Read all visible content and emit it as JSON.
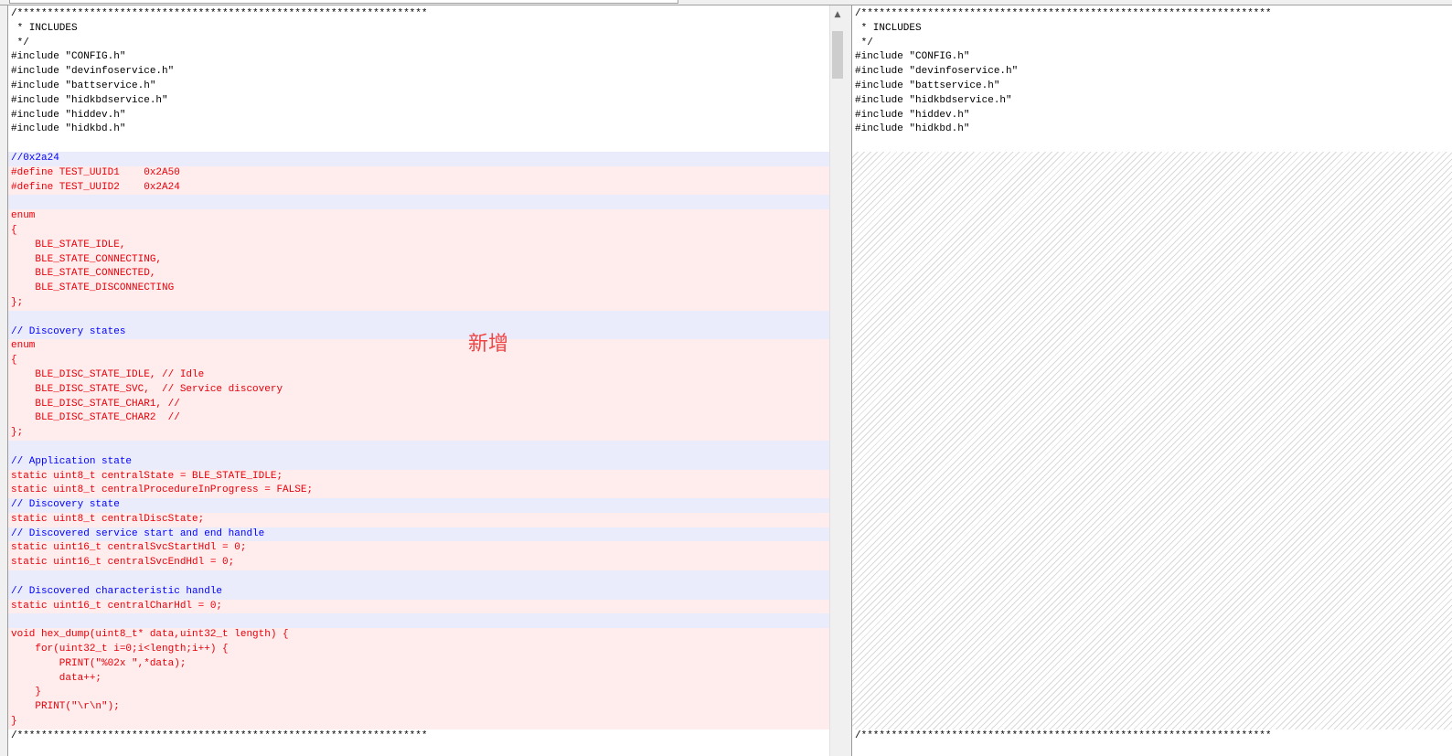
{
  "left_lines": [
    {
      "text": "/********************************************************************",
      "kind": "normal"
    },
    {
      "text": " * INCLUDES",
      "kind": "normal"
    },
    {
      "text": " */",
      "kind": "normal"
    },
    {
      "text": "#include \"CONFIG.h\"",
      "kind": "normal"
    },
    {
      "text": "#include \"devinfoservice.h\"",
      "kind": "normal"
    },
    {
      "text": "#include \"battservice.h\"",
      "kind": "normal"
    },
    {
      "text": "#include \"hidkbdservice.h\"",
      "kind": "normal"
    },
    {
      "text": "#include \"hiddev.h\"",
      "kind": "normal"
    },
    {
      "text": "#include \"hidkbd.h\"",
      "kind": "normal"
    },
    {
      "text": "",
      "kind": "normal"
    },
    {
      "text": "//0x2a24",
      "kind": "comment"
    },
    {
      "text": "#define TEST_UUID1    0x2A50",
      "kind": "added"
    },
    {
      "text": "#define TEST_UUID2    0x2A24",
      "kind": "added"
    },
    {
      "text": "",
      "kind": "blankchg"
    },
    {
      "text": "enum",
      "kind": "added"
    },
    {
      "text": "{",
      "kind": "added"
    },
    {
      "text": "    BLE_STATE_IDLE,",
      "kind": "added"
    },
    {
      "text": "    BLE_STATE_CONNECTING,",
      "kind": "added"
    },
    {
      "text": "    BLE_STATE_CONNECTED,",
      "kind": "added"
    },
    {
      "text": "    BLE_STATE_DISCONNECTING",
      "kind": "added"
    },
    {
      "text": "};",
      "kind": "added"
    },
    {
      "text": "",
      "kind": "blankchg"
    },
    {
      "text": "// Discovery states",
      "kind": "comment"
    },
    {
      "text": "enum",
      "kind": "added"
    },
    {
      "text": "{",
      "kind": "added"
    },
    {
      "text": "    BLE_DISC_STATE_IDLE, // Idle",
      "kind": "added"
    },
    {
      "text": "    BLE_DISC_STATE_SVC,  // Service discovery",
      "kind": "added"
    },
    {
      "text": "    BLE_DISC_STATE_CHAR1, //",
      "kind": "added"
    },
    {
      "text": "    BLE_DISC_STATE_CHAR2  //",
      "kind": "added"
    },
    {
      "text": "};",
      "kind": "added"
    },
    {
      "text": "",
      "kind": "blankchg"
    },
    {
      "text": "// Application state",
      "kind": "comment"
    },
    {
      "text": "static uint8_t centralState = BLE_STATE_IDLE;",
      "kind": "added"
    },
    {
      "text": "static uint8_t centralProcedureInProgress = FALSE;",
      "kind": "added"
    },
    {
      "text": "// Discovery state",
      "kind": "comment"
    },
    {
      "text": "static uint8_t centralDiscState;",
      "kind": "added"
    },
    {
      "text": "// Discovered service start and end handle",
      "kind": "comment"
    },
    {
      "text": "static uint16_t centralSvcStartHdl = 0;",
      "kind": "added"
    },
    {
      "text": "static uint16_t centralSvcEndHdl = 0;",
      "kind": "added"
    },
    {
      "text": "",
      "kind": "blankchg"
    },
    {
      "text": "// Discovered characteristic handle",
      "kind": "comment"
    },
    {
      "text": "static uint16_t centralCharHdl = 0;",
      "kind": "added"
    },
    {
      "text": "",
      "kind": "blankchg"
    },
    {
      "text": "void hex_dump(uint8_t* data,uint32_t length) {",
      "kind": "added"
    },
    {
      "text": "    for(uint32_t i=0;i<length;i++) {",
      "kind": "added"
    },
    {
      "text": "        PRINT(\"%02x \",*data);",
      "kind": "added"
    },
    {
      "text": "        data++;",
      "kind": "added"
    },
    {
      "text": "    }",
      "kind": "added"
    },
    {
      "text": "    PRINT(\"\\r\\n\");",
      "kind": "added"
    },
    {
      "text": "}",
      "kind": "added"
    },
    {
      "text": "/********************************************************************",
      "kind": "normal"
    }
  ],
  "right_lines": [
    {
      "text": "/********************************************************************",
      "kind": "normal"
    },
    {
      "text": " * INCLUDES",
      "kind": "normal"
    },
    {
      "text": " */",
      "kind": "normal"
    },
    {
      "text": "#include \"CONFIG.h\"",
      "kind": "normal"
    },
    {
      "text": "#include \"devinfoservice.h\"",
      "kind": "normal"
    },
    {
      "text": "#include \"battservice.h\"",
      "kind": "normal"
    },
    {
      "text": "#include \"hidkbdservice.h\"",
      "kind": "normal"
    },
    {
      "text": "#include \"hiddev.h\"",
      "kind": "normal"
    },
    {
      "text": "#include \"hidkbd.h\"",
      "kind": "normal"
    },
    {
      "text": "",
      "kind": "normal"
    },
    {
      "text": "",
      "kind": "filler"
    },
    {
      "text": "/********************************************************************",
      "kind": "normal"
    }
  ],
  "annotation": "新增",
  "scroll_up_glyph": "▲"
}
